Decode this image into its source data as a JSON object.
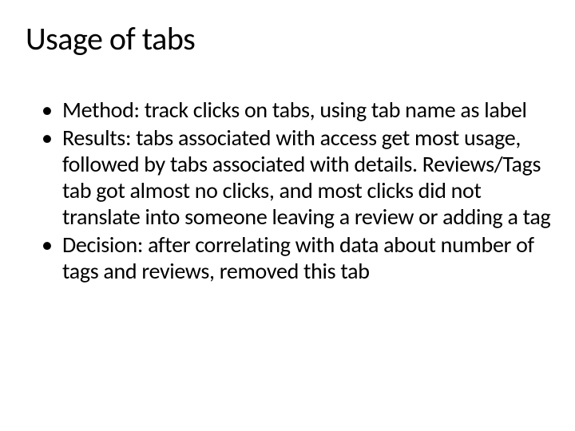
{
  "slide": {
    "title": "Usage of tabs",
    "bullets": [
      "Method: track clicks on tabs, using tab name as label",
      "Results: tabs associated with access get most usage, followed by tabs associated with details. Reviews/Tags tab got almost no clicks, and most clicks did not translate into someone leaving a review or adding a tag",
      "Decision: after correlating with data about number of tags and reviews, removed this tab"
    ]
  }
}
